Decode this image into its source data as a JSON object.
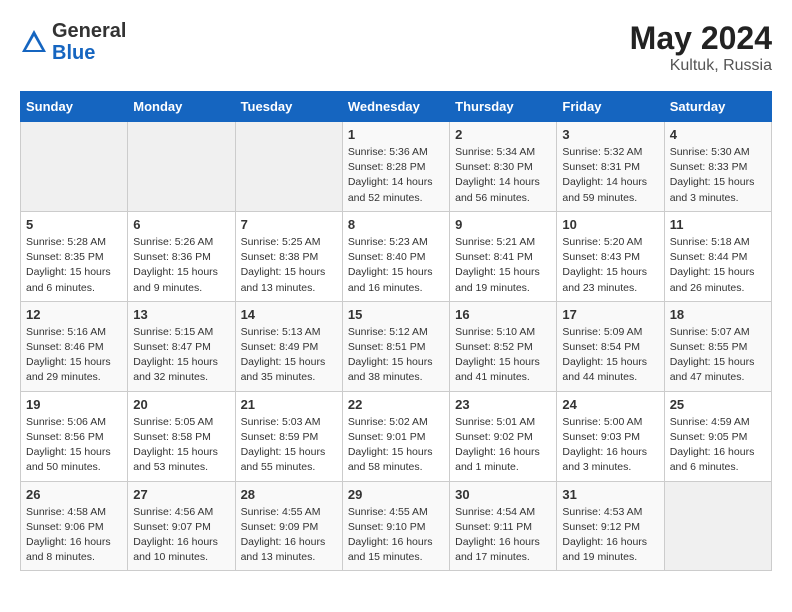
{
  "header": {
    "logo_general": "General",
    "logo_blue": "Blue",
    "month_year": "May 2024",
    "location": "Kultuk, Russia"
  },
  "calendar": {
    "days_of_week": [
      "Sunday",
      "Monday",
      "Tuesday",
      "Wednesday",
      "Thursday",
      "Friday",
      "Saturday"
    ],
    "weeks": [
      [
        {
          "day": "",
          "detail": ""
        },
        {
          "day": "",
          "detail": ""
        },
        {
          "day": "",
          "detail": ""
        },
        {
          "day": "1",
          "detail": "Sunrise: 5:36 AM\nSunset: 8:28 PM\nDaylight: 14 hours\nand 52 minutes."
        },
        {
          "day": "2",
          "detail": "Sunrise: 5:34 AM\nSunset: 8:30 PM\nDaylight: 14 hours\nand 56 minutes."
        },
        {
          "day": "3",
          "detail": "Sunrise: 5:32 AM\nSunset: 8:31 PM\nDaylight: 14 hours\nand 59 minutes."
        },
        {
          "day": "4",
          "detail": "Sunrise: 5:30 AM\nSunset: 8:33 PM\nDaylight: 15 hours\nand 3 minutes."
        }
      ],
      [
        {
          "day": "5",
          "detail": "Sunrise: 5:28 AM\nSunset: 8:35 PM\nDaylight: 15 hours\nand 6 minutes."
        },
        {
          "day": "6",
          "detail": "Sunrise: 5:26 AM\nSunset: 8:36 PM\nDaylight: 15 hours\nand 9 minutes."
        },
        {
          "day": "7",
          "detail": "Sunrise: 5:25 AM\nSunset: 8:38 PM\nDaylight: 15 hours\nand 13 minutes."
        },
        {
          "day": "8",
          "detail": "Sunrise: 5:23 AM\nSunset: 8:40 PM\nDaylight: 15 hours\nand 16 minutes."
        },
        {
          "day": "9",
          "detail": "Sunrise: 5:21 AM\nSunset: 8:41 PM\nDaylight: 15 hours\nand 19 minutes."
        },
        {
          "day": "10",
          "detail": "Sunrise: 5:20 AM\nSunset: 8:43 PM\nDaylight: 15 hours\nand 23 minutes."
        },
        {
          "day": "11",
          "detail": "Sunrise: 5:18 AM\nSunset: 8:44 PM\nDaylight: 15 hours\nand 26 minutes."
        }
      ],
      [
        {
          "day": "12",
          "detail": "Sunrise: 5:16 AM\nSunset: 8:46 PM\nDaylight: 15 hours\nand 29 minutes."
        },
        {
          "day": "13",
          "detail": "Sunrise: 5:15 AM\nSunset: 8:47 PM\nDaylight: 15 hours\nand 32 minutes."
        },
        {
          "day": "14",
          "detail": "Sunrise: 5:13 AM\nSunset: 8:49 PM\nDaylight: 15 hours\nand 35 minutes."
        },
        {
          "day": "15",
          "detail": "Sunrise: 5:12 AM\nSunset: 8:51 PM\nDaylight: 15 hours\nand 38 minutes."
        },
        {
          "day": "16",
          "detail": "Sunrise: 5:10 AM\nSunset: 8:52 PM\nDaylight: 15 hours\nand 41 minutes."
        },
        {
          "day": "17",
          "detail": "Sunrise: 5:09 AM\nSunset: 8:54 PM\nDaylight: 15 hours\nand 44 minutes."
        },
        {
          "day": "18",
          "detail": "Sunrise: 5:07 AM\nSunset: 8:55 PM\nDaylight: 15 hours\nand 47 minutes."
        }
      ],
      [
        {
          "day": "19",
          "detail": "Sunrise: 5:06 AM\nSunset: 8:56 PM\nDaylight: 15 hours\nand 50 minutes."
        },
        {
          "day": "20",
          "detail": "Sunrise: 5:05 AM\nSunset: 8:58 PM\nDaylight: 15 hours\nand 53 minutes."
        },
        {
          "day": "21",
          "detail": "Sunrise: 5:03 AM\nSunset: 8:59 PM\nDaylight: 15 hours\nand 55 minutes."
        },
        {
          "day": "22",
          "detail": "Sunrise: 5:02 AM\nSunset: 9:01 PM\nDaylight: 15 hours\nand 58 minutes."
        },
        {
          "day": "23",
          "detail": "Sunrise: 5:01 AM\nSunset: 9:02 PM\nDaylight: 16 hours\nand 1 minute."
        },
        {
          "day": "24",
          "detail": "Sunrise: 5:00 AM\nSunset: 9:03 PM\nDaylight: 16 hours\nand 3 minutes."
        },
        {
          "day": "25",
          "detail": "Sunrise: 4:59 AM\nSunset: 9:05 PM\nDaylight: 16 hours\nand 6 minutes."
        }
      ],
      [
        {
          "day": "26",
          "detail": "Sunrise: 4:58 AM\nSunset: 9:06 PM\nDaylight: 16 hours\nand 8 minutes."
        },
        {
          "day": "27",
          "detail": "Sunrise: 4:56 AM\nSunset: 9:07 PM\nDaylight: 16 hours\nand 10 minutes."
        },
        {
          "day": "28",
          "detail": "Sunrise: 4:55 AM\nSunset: 9:09 PM\nDaylight: 16 hours\nand 13 minutes."
        },
        {
          "day": "29",
          "detail": "Sunrise: 4:55 AM\nSunset: 9:10 PM\nDaylight: 16 hours\nand 15 minutes."
        },
        {
          "day": "30",
          "detail": "Sunrise: 4:54 AM\nSunset: 9:11 PM\nDaylight: 16 hours\nand 17 minutes."
        },
        {
          "day": "31",
          "detail": "Sunrise: 4:53 AM\nSunset: 9:12 PM\nDaylight: 16 hours\nand 19 minutes."
        },
        {
          "day": "",
          "detail": ""
        }
      ]
    ]
  }
}
